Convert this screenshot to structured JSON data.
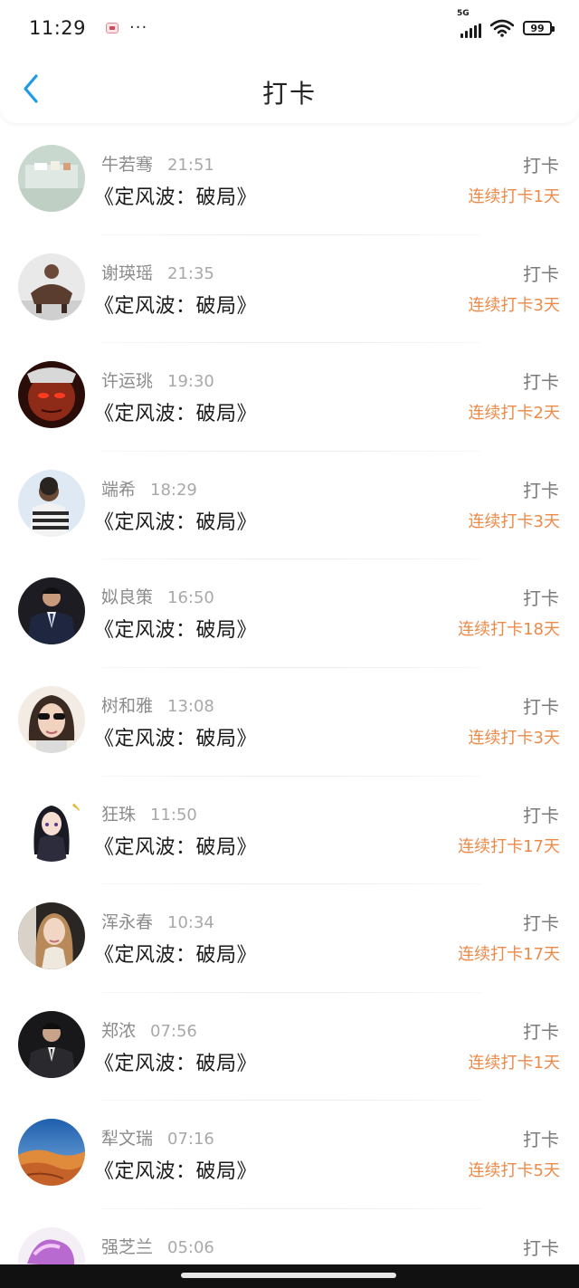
{
  "status_bar": {
    "time": "11:29",
    "dots": "···",
    "network": "5G",
    "battery": "99"
  },
  "nav": {
    "title": "打卡",
    "back_icon": "chevron-left-icon"
  },
  "colors": {
    "accent_blue": "#1e9be8",
    "streak_orange": "#ec8a48"
  },
  "items": [
    {
      "name": "牛若骞",
      "time": "21:51",
      "title": "《定风波：破局》",
      "action": "打卡",
      "streak": "连续打卡1天"
    },
    {
      "name": "谢瑛瑶",
      "time": "21:35",
      "title": "《定风波：破局》",
      "action": "打卡",
      "streak": "连续打卡3天"
    },
    {
      "name": "许运珧",
      "time": "19:30",
      "title": "《定风波：破局》",
      "action": "打卡",
      "streak": "连续打卡2天"
    },
    {
      "name": "端希",
      "time": "18:29",
      "title": "《定风波：破局》",
      "action": "打卡",
      "streak": "连续打卡3天"
    },
    {
      "name": "姒良策",
      "time": "16:50",
      "title": "《定风波：破局》",
      "action": "打卡",
      "streak": "连续打卡18天"
    },
    {
      "name": "树和雅",
      "time": "13:08",
      "title": "《定风波：破局》",
      "action": "打卡",
      "streak": "连续打卡3天"
    },
    {
      "name": "狂珠",
      "time": "11:50",
      "title": "《定风波：破局》",
      "action": "打卡",
      "streak": "连续打卡17天"
    },
    {
      "name": "浑永春",
      "time": "10:34",
      "title": "《定风波：破局》",
      "action": "打卡",
      "streak": "连续打卡17天"
    },
    {
      "name": "郑浓",
      "time": "07:56",
      "title": "《定风波：破局》",
      "action": "打卡",
      "streak": "连续打卡1天"
    },
    {
      "name": "犁文瑞",
      "time": "07:16",
      "title": "《定风波：破局》",
      "action": "打卡",
      "streak": "连续打卡5天"
    },
    {
      "name": "强芝兰",
      "time": "05:06",
      "title": "",
      "action": "打卡",
      "streak": ""
    }
  ]
}
